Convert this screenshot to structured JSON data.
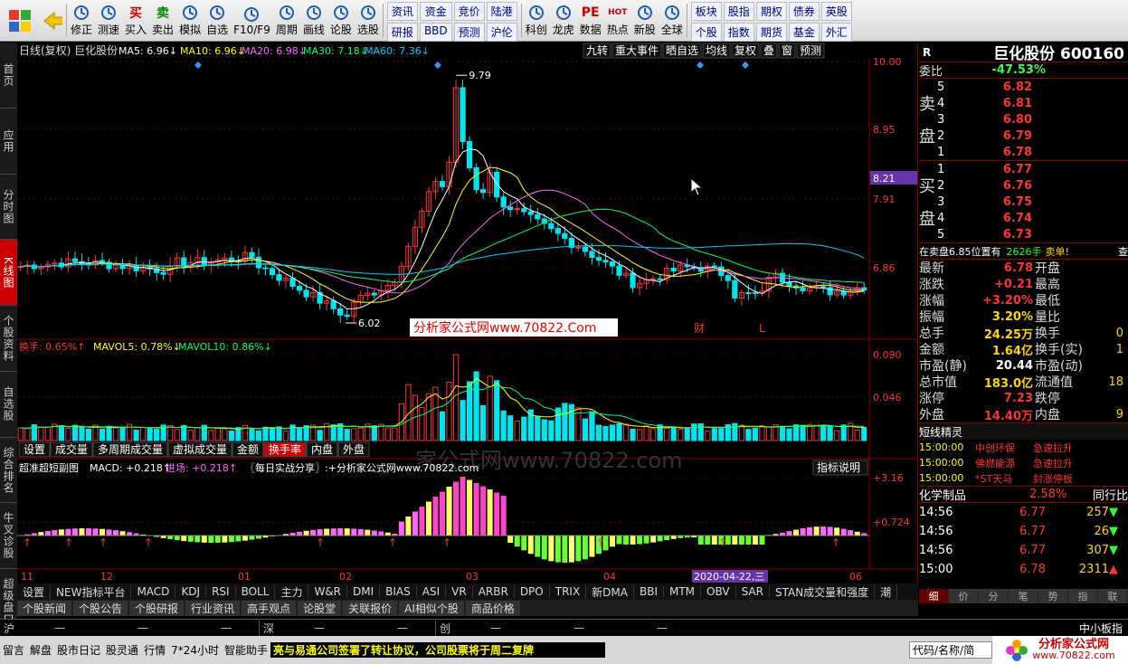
{
  "toolbar": {
    "buttons": [
      {
        "label": "修正",
        "icon": "up-down-icon"
      },
      {
        "label": "测速",
        "icon": "speed-icon"
      },
      {
        "label": "买入",
        "icon": "buy-icon",
        "glyph": "买"
      },
      {
        "label": "卖出",
        "icon": "sell-icon",
        "glyph": "卖"
      },
      {
        "label": "模拟",
        "icon": "hammer-icon"
      },
      {
        "label": "自选",
        "icon": "folder-icon"
      },
      {
        "label": "F10/F9",
        "icon": "f10-icon"
      },
      {
        "label": "周期",
        "icon": "clock-icon"
      },
      {
        "label": "画线",
        "icon": "pen-icon"
      },
      {
        "label": "论股",
        "icon": "chat-icon"
      },
      {
        "label": "选股",
        "icon": "magnifier-icon"
      }
    ],
    "grid1": [
      "资讯",
      "研报",
      "资金",
      "BBD",
      "竞价",
      "预测",
      "陆港",
      "沪伦"
    ],
    "buttons2": [
      {
        "label": "科创",
        "icon": "chart-icon"
      },
      {
        "label": "龙虎",
        "icon": "dragon-icon"
      },
      {
        "label": "数据",
        "icon": "pe-icon",
        "glyph": "PE"
      },
      {
        "label": "热点",
        "icon": "hot-icon",
        "glyph": "HOT"
      },
      {
        "label": "新股",
        "icon": "newstock-icon"
      },
      {
        "label": "全球",
        "icon": "globe-icon"
      }
    ],
    "grid2": [
      "板块",
      "个股",
      "股指",
      "指数",
      "期权",
      "期货",
      "债券",
      "基金",
      "英股",
      "外汇"
    ]
  },
  "sidebar": [
    "首页",
    "应用",
    "分时图",
    "K线图",
    "个股资料",
    "自选股",
    "综合排名",
    "牛叉诊股",
    "超级盘口"
  ],
  "chart": {
    "header": "日线(复权) 巨化股份",
    "ma": [
      {
        "label": "MA5: 6.96↓",
        "color": "#ffffff"
      },
      {
        "label": "MA10: 6.96↓",
        "color": "#ffff00"
      },
      {
        "label": "MA20: 6.98↓",
        "color": "#ff66ff"
      },
      {
        "label": "MA30: 7.18↓",
        "color": "#00ff66"
      },
      {
        "label": "MA60: 7.36↓",
        "color": "#00ccff"
      }
    ],
    "buttons": [
      "九转",
      "重大事件",
      "晒自选",
      "均线",
      "复权",
      "叠",
      "窗",
      "预测"
    ],
    "price_axis": [
      "10.00",
      "8.95",
      "7.91",
      "6.86"
    ],
    "current_price": "8.21",
    "high_label": "9.79",
    "low_label": "6.02",
    "marks": [
      "财",
      "L"
    ],
    "watermark": "分析家公式网www.70822.Com",
    "vol_header": [
      {
        "label": "换手: 0.65%↑",
        "color": "#ff3333"
      },
      {
        "label": "MAVOL5: 0.78%↓",
        "color": "#ffff00"
      },
      {
        "label": "MAVOL10: 0.86%↓",
        "color": "#00ff66"
      }
    ],
    "vol_axis": [
      "0.090",
      "0.046"
    ],
    "vol_tabs": [
      "设置",
      "成交量",
      "多周期成交量",
      "虚拟成交量",
      "金额",
      "换手率",
      "内盘",
      "外盘"
    ],
    "macd_header": [
      {
        "label": "超准超短副图",
        "color": "#ffffff"
      },
      {
        "label": "MACD: +0.218↑",
        "color": "#ffffff"
      },
      {
        "label": "进场: +0.218↑",
        "color": "#ff66ff"
      },
      {
        "label": "〖每日实战分享〗:+分析家公式网www.70822.com",
        "color": "#ffffff"
      }
    ],
    "macd_btn": "指标说明",
    "macd_axis": [
      "+3.16",
      "+0.724"
    ],
    "watermark2": "家公式网www.70822.com",
    "months": [
      "11",
      "12",
      "01",
      "02",
      "03",
      "04",
      "06"
    ],
    "date_badge": "2020-04-22,三"
  },
  "bottom_tabs": [
    "设置",
    "NEW指标平台",
    "MACD",
    "KDJ",
    "RSI",
    "BOLL",
    "主力",
    "W&R",
    "DMI",
    "BIAS",
    "ASI",
    "VR",
    "ARBR",
    "DPO",
    "TRIX",
    "新DMA",
    "BBI",
    "MTM",
    "OBV",
    "SAR",
    "STAN成交量和强度",
    "潮"
  ],
  "info_tabs": [
    "个股新闻",
    "个股公告",
    "个股研报",
    "行业资讯",
    "高手观点",
    "论股堂",
    "关联报价",
    "AI相似个股",
    "商品价格"
  ],
  "right": {
    "r": "R",
    "name": "巨化股份",
    "code": "600160",
    "webi_label": "委比",
    "webi": "-47.53%",
    "sell_label": [
      "卖",
      "盘"
    ],
    "buy_label": [
      "买",
      "盘"
    ],
    "asks": [
      {
        "lv": "5",
        "price": "6.82"
      },
      {
        "lv": "4",
        "price": "6.81"
      },
      {
        "lv": "3",
        "price": "6.80"
      },
      {
        "lv": "2",
        "price": "6.79"
      },
      {
        "lv": "1",
        "price": "6.78"
      }
    ],
    "bids": [
      {
        "lv": "1",
        "price": "6.77"
      },
      {
        "lv": "2",
        "price": "6.76"
      },
      {
        "lv": "3",
        "price": "6.75"
      },
      {
        "lv": "4",
        "price": "6.74"
      },
      {
        "lv": "5",
        "price": "6.73"
      }
    ],
    "order_note": "在卖盘6.85位置有",
    "order_qty": "2626手",
    "order_tag": "卖单!",
    "order_btn": "查",
    "stats": [
      {
        "k": "最新",
        "v": "6.78",
        "c": "red",
        "k2": "开盘",
        "v2": ""
      },
      {
        "k": "涨跌",
        "v": "+0.21",
        "c": "red",
        "k2": "最高",
        "v2": ""
      },
      {
        "k": "涨幅",
        "v": "+3.20%",
        "c": "red",
        "k2": "最低",
        "v2": ""
      },
      {
        "k": "振幅",
        "v": "3.20%",
        "c": "yellow",
        "k2": "量比",
        "v2": ""
      },
      {
        "k": "总手",
        "v": "24.25万",
        "c": "yellow",
        "k2": "换手",
        "v2": "0"
      },
      {
        "k": "金额",
        "v": "1.64亿",
        "c": "yellow",
        "k2": "换手(实)",
        "v2": "1"
      },
      {
        "k": "市盈(静)",
        "v": "20.44",
        "c": "white",
        "k2": "市盈(动)",
        "v2": ""
      },
      {
        "k": "总市值",
        "v": "183.0亿",
        "c": "yellow",
        "k2": "流通值",
        "v2": "18"
      },
      {
        "k": "涨停",
        "v": "7.23",
        "c": "red",
        "k2": "跌停",
        "v2": ""
      },
      {
        "k": "外盘",
        "v": "14.40万",
        "c": "red",
        "k2": "内盘",
        "v2": "9"
      }
    ],
    "spirit_title": "短线精灵",
    "spirit": [
      {
        "t": "15:00:00",
        "n": "中创环保",
        "e": "急速拉升"
      },
      {
        "t": "15:00:00",
        "n": "佛燃能源",
        "e": "急速拉升"
      },
      {
        "t": "15:00:00",
        "n": "*ST天马",
        "e": "封涨停板"
      }
    ],
    "industry": "化学制品",
    "industry_pct": "2.58%",
    "industry_btn": "同行比",
    "ticks": [
      {
        "t": "14:56",
        "p": "6.77",
        "v": "257",
        "d": "down"
      },
      {
        "t": "14:56",
        "p": "6.77",
        "v": "26",
        "d": "down"
      },
      {
        "t": "14:56",
        "p": "6.77",
        "v": "307",
        "d": "down"
      },
      {
        "t": "15:00",
        "p": "6.78",
        "v": "2311",
        "d": "up"
      }
    ],
    "rtabs": [
      "细",
      "价",
      "分",
      "笔",
      "势",
      "指",
      "联"
    ]
  },
  "index_bar": {
    "hu": "沪",
    "shen": "深",
    "chuang": "创",
    "zxb": "中小板指",
    "dash": "—"
  },
  "status": {
    "items": [
      "留言",
      "解盘",
      "股市日记",
      "股灵通",
      "行情",
      "7*24小时",
      "智能助手"
    ],
    "news": "亮与易通公司签署了转让协议，公司股票将于周二复牌",
    "search": "代码/名称/简",
    "brand": "分析家公式网",
    "brand_url": "www.70822.com"
  },
  "colors": {
    "up": "#ff3333",
    "down": "#00e5ee",
    "ma5": "#ffffff",
    "ma10": "#ffff00",
    "ma20": "#ff66ff",
    "ma30": "#00ff66",
    "ma60": "#00ccff"
  }
}
